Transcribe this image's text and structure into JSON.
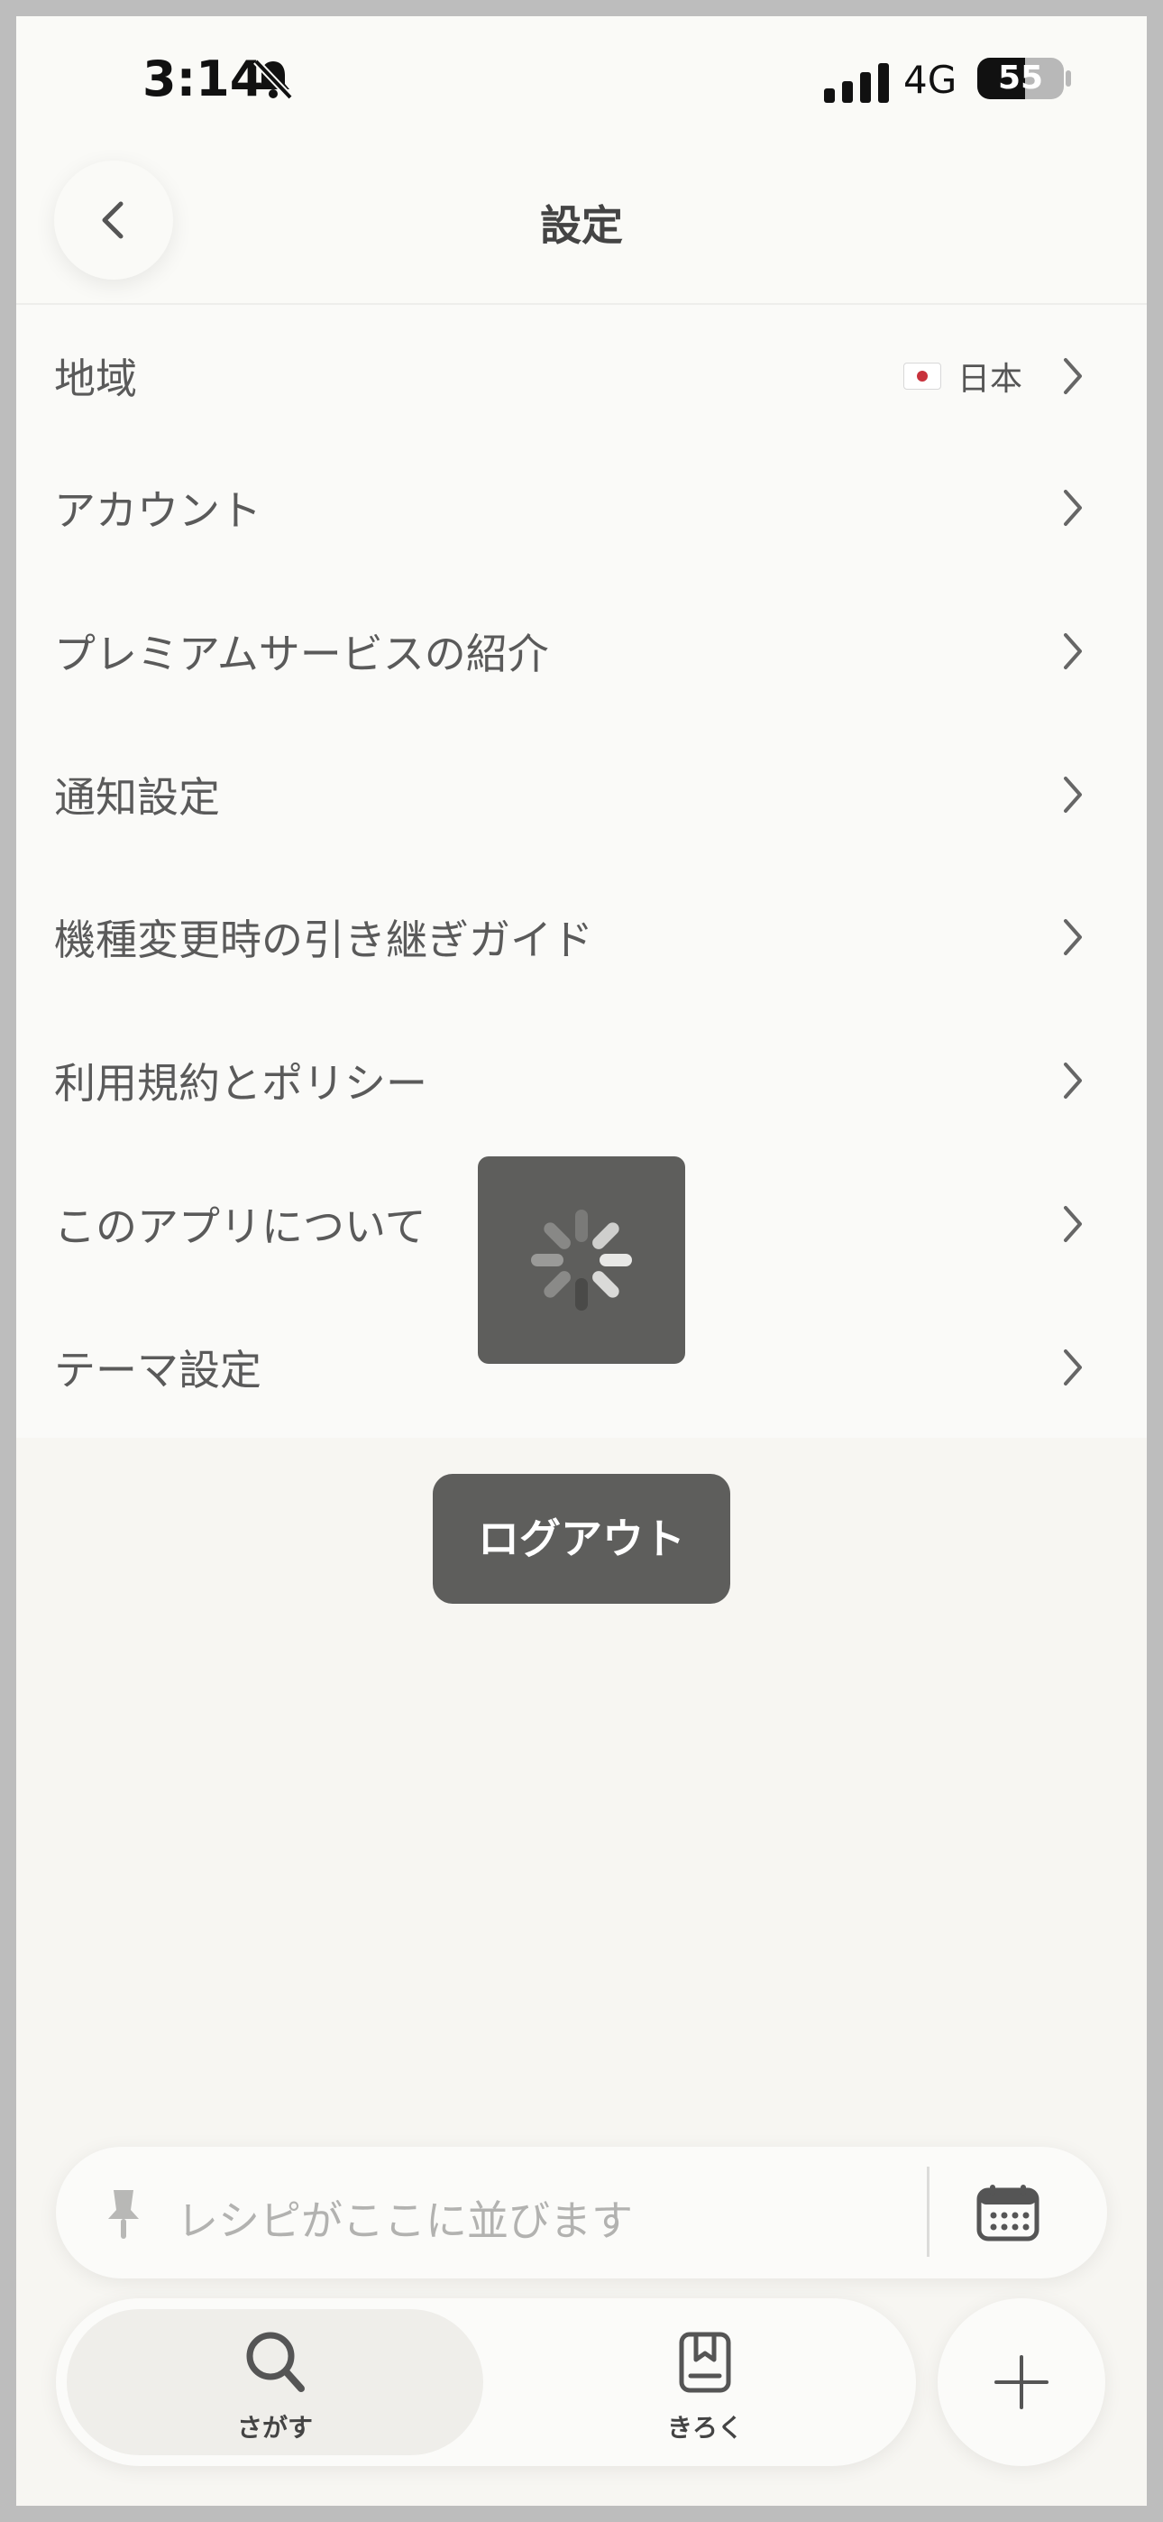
{
  "status_bar": {
    "time": "3:14",
    "network": "4G",
    "battery": "55",
    "battery_level": 0.55
  },
  "header": {
    "title": "設定"
  },
  "settings": {
    "items": [
      {
        "label": "地域",
        "value": "日本"
      },
      {
        "label": "アカウント"
      },
      {
        "label": "プレミアムサービスの紹介"
      },
      {
        "label": "通知設定"
      },
      {
        "label": "機種変更時の引き継ぎガイド"
      },
      {
        "label": "利用規約とポリシー"
      },
      {
        "label": "このアプリについて"
      },
      {
        "label": "テーマ設定"
      }
    ]
  },
  "logout_label": "ログアウト",
  "recipe_bar": {
    "placeholder": "レシピがここに並びます"
  },
  "tabs": [
    {
      "label": "さがす",
      "icon": "search-icon"
    },
    {
      "label": "きろく",
      "icon": "book-icon"
    }
  ],
  "colors": {
    "background": "#f7f6f2",
    "dark_button": "#5e5e5c",
    "text": "#5a5a5a"
  }
}
